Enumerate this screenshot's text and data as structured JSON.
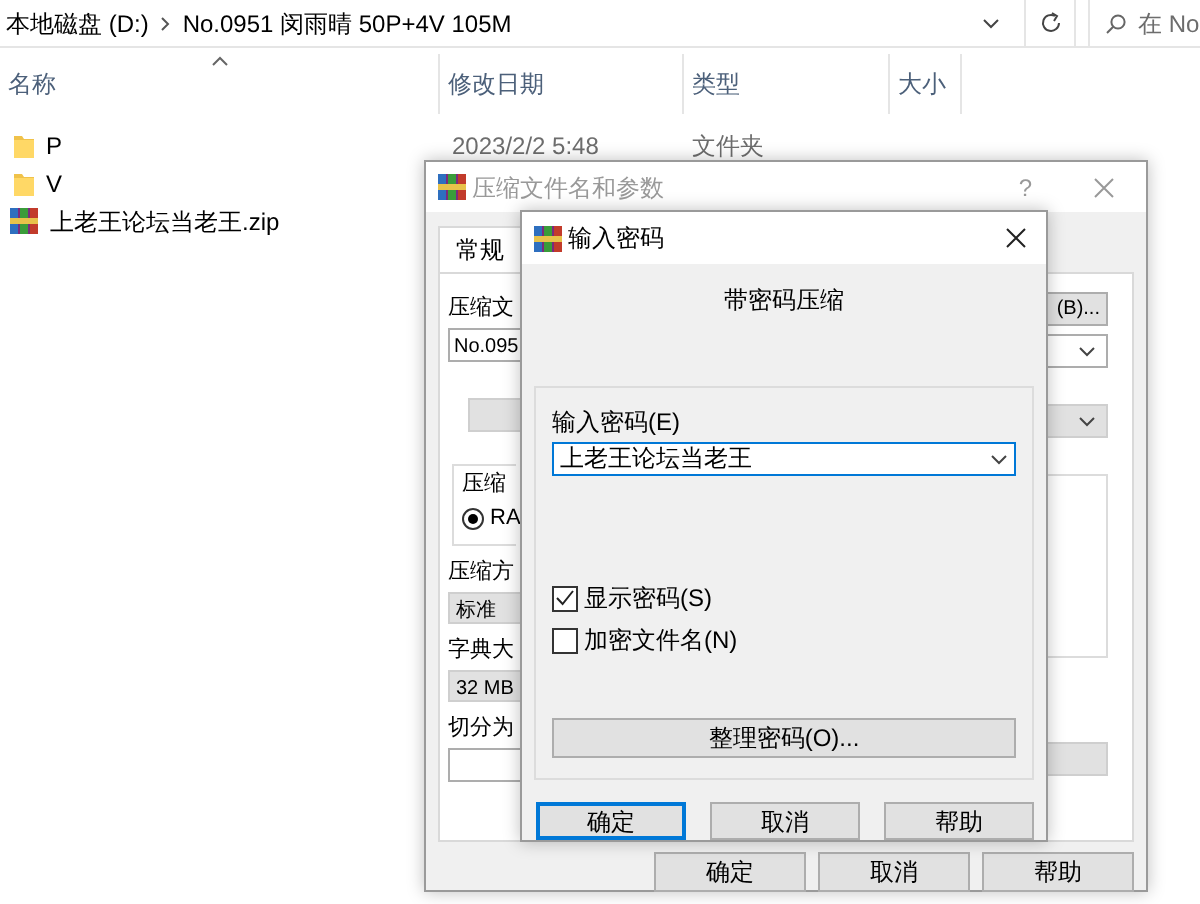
{
  "explorer": {
    "breadcrumb": [
      "本地磁盘 (D:)",
      "No.0951 闵雨晴 50P+4V 105M"
    ],
    "search": {
      "placeholder": "在 No"
    },
    "columns": [
      "名称",
      "修改日期",
      "类型",
      "大小"
    ],
    "rows": [
      {
        "kind": "folder",
        "name": "P",
        "modified": "2023/2/2 5:48",
        "type": "文件夹"
      },
      {
        "kind": "folder",
        "name": "V"
      },
      {
        "kind": "archive",
        "name": "上老王论坛当老王.zip"
      }
    ]
  },
  "archive_dialog": {
    "title": "压缩文件名和参数",
    "help": "?",
    "tabs": [
      {
        "label": "常规",
        "selected": true
      }
    ],
    "archive_label": "压缩文",
    "archive_name": "No.095",
    "browse_button": "(B)...",
    "group_label": "压缩",
    "format_option": {
      "label": "RA",
      "selected": true
    },
    "method_label": "压缩方",
    "method": "标准",
    "dictionary_label": "字典大",
    "dictionary": "32 MB",
    "split_label": "切分为",
    "buttons": [
      "确定",
      "取消",
      "帮助"
    ]
  },
  "password_dialog": {
    "title": "输入密码",
    "heading": "带密码压缩",
    "password_label": "输入密码(E)",
    "password": "上老王论坛当老王",
    "options": [
      {
        "label": "显示密码(S)",
        "checked": true
      },
      {
        "label": "加密文件名(N)",
        "checked": false
      }
    ],
    "organize_button": "整理密码(O)...",
    "buttons": [
      {
        "label": "确定",
        "default": true
      },
      {
        "label": "取消",
        "default": false
      },
      {
        "label": "帮助",
        "default": false
      }
    ]
  }
}
